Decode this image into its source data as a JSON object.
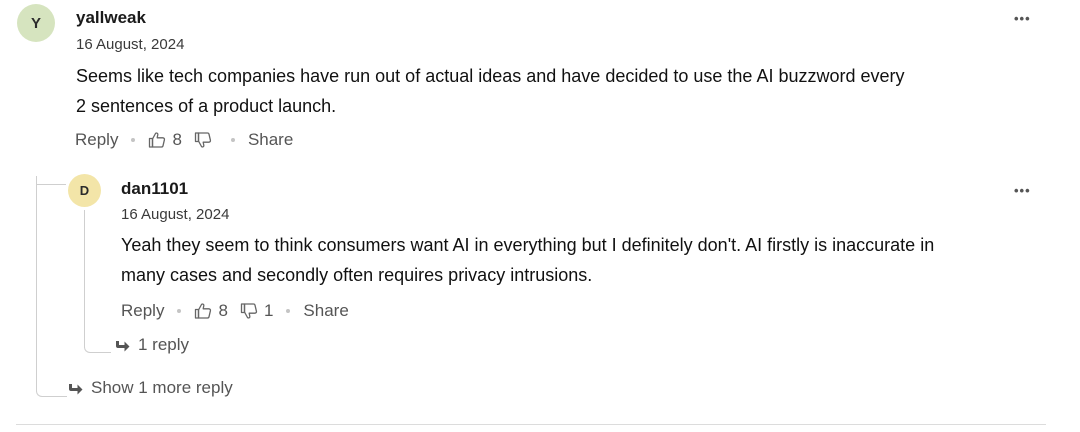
{
  "comments": [
    {
      "avatar_letter": "Y",
      "avatar_color": "#d6e4bf",
      "username": "yallweak",
      "date": "16 August, 2024",
      "text_line1": "Seems like tech companies have run out of actual ideas and have decided to use the AI buzzword every",
      "text_line2": "2 sentences of a product launch.",
      "reply_label": "Reply",
      "likes": "8",
      "dislikes": "",
      "share_label": "Share",
      "more_label": "•••"
    },
    {
      "avatar_letter": "D",
      "avatar_color": "#f3e5a8",
      "username": "dan1101",
      "date": "16 August, 2024",
      "text_line1": "Yeah they seem to think consumers want AI in everything but I definitely don't.  AI firstly is inaccurate in",
      "text_line2": "many cases and secondly often requires privacy intrusions.",
      "reply_label": "Reply",
      "likes": "8",
      "dislikes": "1",
      "share_label": "Share",
      "more_label": "•••",
      "replies_label": "1 reply"
    }
  ],
  "show_more_label": "Show 1 more reply",
  "icons": {
    "thumbs_up": "thumbs-up-icon",
    "thumbs_down": "thumbs-down-icon",
    "reply_arrow": "reply-arrow-icon",
    "more": "more-options-icon"
  },
  "colors": {
    "text": "#1a1a1a",
    "muted": "#555555",
    "line": "#cfcfcf"
  }
}
